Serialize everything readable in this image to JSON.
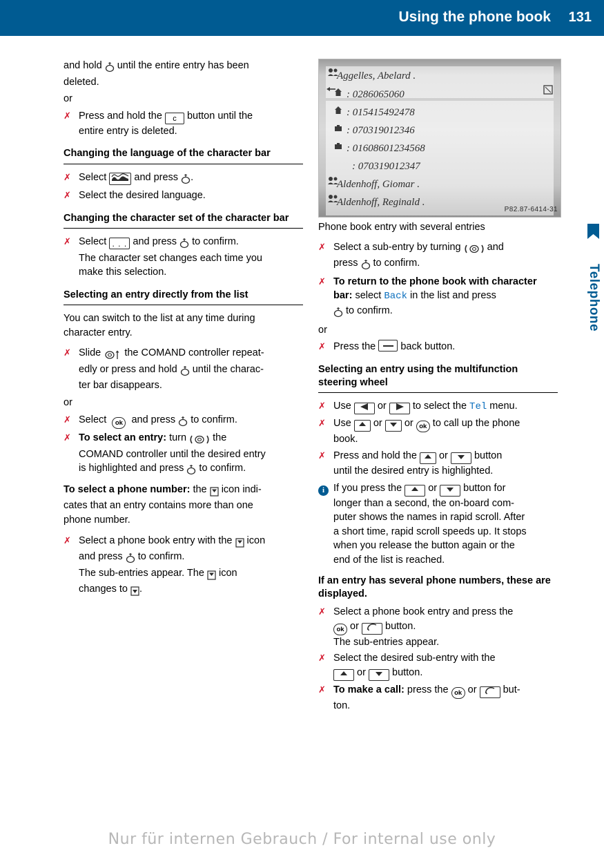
{
  "header": {
    "title": "Using the phone book",
    "page": "131",
    "side_label": "Telephone"
  },
  "left_column": {
    "b1_line1": "and hold",
    "b1_line2": "until the entire entry has been",
    "b1_line3": "deleted.",
    "or1": "or",
    "b2_pre": "Press and hold the",
    "b2_icon": "c",
    "b2_post": "button until the",
    "b2_line2": "entire entry is deleted.",
    "h1": "Changing the language of the character bar",
    "b3_pre": "Select",
    "b3_mid": "and press",
    "b3_post": ".",
    "b4": "Select the desired language.",
    "h2": "Changing the character set of the character bar",
    "b5_pre": "Select",
    "b5_icon": ". . .",
    "b5_mid": "and press",
    "b5_post": "to confirm.",
    "b5_l2": "The character set changes each time you",
    "b5_l3": "make this selection.",
    "h3": "Selecting an entry directly from the list",
    "p1_l1": "You can switch to the list at any time during",
    "p1_l2": "character entry.",
    "b6_pre": "Slide",
    "b6_mid": "the COMAND controller repeat-",
    "b6_l2": "edly or press and hold",
    "b6_l2b": "until the charac-",
    "b6_l3": "ter bar disappears.",
    "or2": "or",
    "b7_pre": "Select",
    "b7_mid": "and press",
    "b7_post": "to confirm.",
    "b8_bold": "To select an entry:",
    "b8_pre": "turn",
    "b8_post": "the",
    "b8_l2": "COMAND controller until the desired entry",
    "b8_l3a": "is highlighted and press",
    "b8_l3b": "to confirm.",
    "p2_bold": "To select a phone number:",
    "p2_pre": "the",
    "p2_post": "icon indi-",
    "p2_l2": "cates that an entry contains more than one",
    "p2_l3": "phone number.",
    "b9_pre": "Select a phone book entry with the",
    "b9_post": "icon",
    "b9_l2a": "and press",
    "b9_l2b": "to confirm.",
    "b9_l3a": "The sub-entries appear. The",
    "b9_l3b": "icon",
    "b9_l4a": "changes to",
    "b9_l4b": "."
  },
  "figure": {
    "rows": [
      "Aggelles, Abelard .",
      ": 0286065060",
      ": 015415492478",
      ": 070319012346",
      ": 01608601234568",
      ": 070319012347",
      "Aldenhoff, Giomar .",
      "Aldenhoff, Reginald ."
    ],
    "credit": "P82.87-6414-31",
    "caption": "Phone book entry with several entries"
  },
  "right_column": {
    "b1_pre": "Select a sub-entry by turning",
    "b1_post": "and",
    "b1_l2a": "press",
    "b1_l2b": "to confirm.",
    "b2_bold": "To return to the phone book with character bar:",
    "b2_pre": "select",
    "b2_link": "Back",
    "b2_post": "in the list and press",
    "b2_l2": "to confirm.",
    "or1": "or",
    "b3_pre": "Press the",
    "b3_post": "back button.",
    "h1": "Selecting an entry using the multifunction steering wheel",
    "b4_pre": "Use",
    "b4_or": "or",
    "b4_post": "to select the",
    "b4_menu": "Tel",
    "b4_end": "menu.",
    "b5_pre": "Use",
    "b5_or1": "or",
    "b5_or2": "or",
    "b5_post": "to call up the phone",
    "b5_l2": "book.",
    "b6_pre": "Press and hold the",
    "b6_or": "or",
    "b6_post": "button",
    "b6_l2": "until the desired entry is highlighted.",
    "note_pre": "If you press the",
    "note_or": "or",
    "note_post": "button for",
    "note_l2": "longer than a second, the on-board com-",
    "note_l3": "puter shows the names in rapid scroll. After",
    "note_l4": "a short time, rapid scroll speeds up. It stops",
    "note_l5": "when you release the button again or the",
    "note_l6": "end of the list is reached.",
    "h2": "If an entry has several phone numbers, these are displayed.",
    "b7_l1": "Select a phone book entry and press the",
    "b7_l2a": "or",
    "b7_l2b": "button.",
    "b7_l3": "The sub-entries appear.",
    "b8_l1": "Select the desired sub-entry with the",
    "b8_l2a": "or",
    "b8_l2b": "button.",
    "b9_bold": "To make a call:",
    "b9_pre": "press the",
    "b9_or": "or",
    "b9_post": "but-",
    "b9_l2": "ton."
  },
  "footer": {
    "watermark": "Nur für internen Gebrauch / For internal use only"
  },
  "colors": {
    "header_bg": "#005b92",
    "marker_red": "#d2152b",
    "link_blue": "#0a6ebd"
  }
}
